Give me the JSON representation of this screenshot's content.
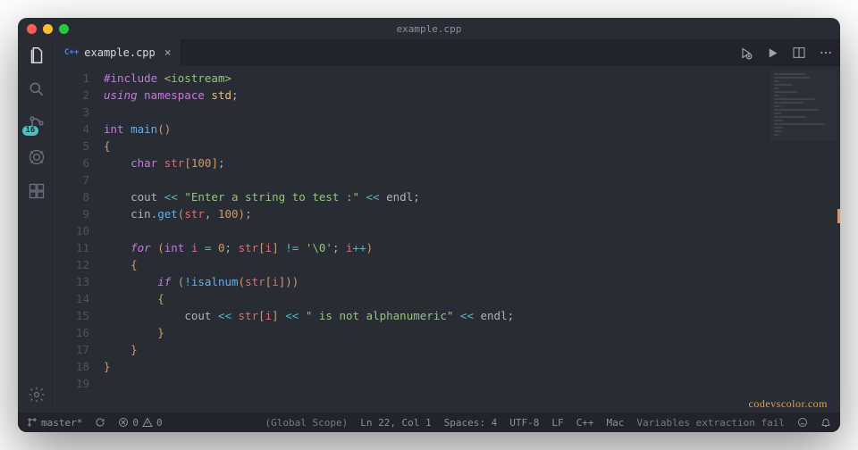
{
  "window": {
    "title": "example.cpp"
  },
  "tab": {
    "lang": "C++",
    "name": "example.cpp"
  },
  "activity": {
    "scm_badge": "16"
  },
  "code": {
    "lines": [
      {
        "n": 1,
        "tokens": [
          [
            "inc",
            "#include "
          ],
          [
            "hdr",
            "<iostream>"
          ]
        ]
      },
      {
        "n": 2,
        "tokens": [
          [
            "kw",
            "using "
          ],
          [
            "kw2",
            "namespace "
          ],
          [
            "ns",
            "std"
          ],
          [
            "pun",
            ";"
          ]
        ]
      },
      {
        "n": 3,
        "tokens": []
      },
      {
        "n": 4,
        "tokens": [
          [
            "ty",
            "int "
          ],
          [
            "fn",
            "main"
          ],
          [
            "br",
            "()"
          ]
        ]
      },
      {
        "n": 5,
        "tokens": [
          [
            "br",
            "{"
          ]
        ]
      },
      {
        "n": 6,
        "tokens": [
          [
            "id",
            "    "
          ],
          [
            "ty",
            "char "
          ],
          [
            "var",
            "str"
          ],
          [
            "br",
            "["
          ],
          [
            "num",
            "100"
          ],
          [
            "br",
            "]"
          ],
          [
            "pun",
            ";"
          ]
        ]
      },
      {
        "n": 7,
        "tokens": []
      },
      {
        "n": 8,
        "tokens": [
          [
            "id",
            "    "
          ],
          [
            "id",
            "cout "
          ],
          [
            "op",
            "<< "
          ],
          [
            "str",
            "\"Enter a string to test :\""
          ],
          [
            "op",
            " << "
          ],
          [
            "id",
            "endl"
          ],
          [
            "pun",
            ";"
          ]
        ]
      },
      {
        "n": 9,
        "tokens": [
          [
            "id",
            "    "
          ],
          [
            "id",
            "cin"
          ],
          [
            "pun",
            "."
          ],
          [
            "fn",
            "get"
          ],
          [
            "br",
            "("
          ],
          [
            "var",
            "str"
          ],
          [
            "pun",
            ", "
          ],
          [
            "num",
            "100"
          ],
          [
            "br",
            ")"
          ],
          [
            "pun",
            ";"
          ]
        ]
      },
      {
        "n": 10,
        "tokens": []
      },
      {
        "n": 11,
        "tokens": [
          [
            "id",
            "    "
          ],
          [
            "kw",
            "for "
          ],
          [
            "br",
            "("
          ],
          [
            "ty",
            "int "
          ],
          [
            "var",
            "i"
          ],
          [
            "op",
            " = "
          ],
          [
            "num",
            "0"
          ],
          [
            "pun",
            "; "
          ],
          [
            "var",
            "str"
          ],
          [
            "br",
            "["
          ],
          [
            "var",
            "i"
          ],
          [
            "br",
            "]"
          ],
          [
            "op",
            " != "
          ],
          [
            "chr",
            "'\\0'"
          ],
          [
            "pun",
            "; "
          ],
          [
            "var",
            "i"
          ],
          [
            "op",
            "++"
          ],
          [
            "br",
            ")"
          ]
        ]
      },
      {
        "n": 12,
        "tokens": [
          [
            "id",
            "    "
          ],
          [
            "br",
            "{"
          ]
        ]
      },
      {
        "n": 13,
        "tokens": [
          [
            "id",
            "        "
          ],
          [
            "kw",
            "if "
          ],
          [
            "br",
            "("
          ],
          [
            "op",
            "!"
          ],
          [
            "fn",
            "isalnum"
          ],
          [
            "br",
            "("
          ],
          [
            "var",
            "str"
          ],
          [
            "br",
            "["
          ],
          [
            "var",
            "i"
          ],
          [
            "br",
            "]"
          ],
          [
            "br",
            ")"
          ],
          [
            "br",
            ")"
          ]
        ]
      },
      {
        "n": 14,
        "tokens": [
          [
            "id",
            "        "
          ],
          [
            "br",
            "{"
          ]
        ]
      },
      {
        "n": 15,
        "tokens": [
          [
            "id",
            "            "
          ],
          [
            "id",
            "cout "
          ],
          [
            "op",
            "<< "
          ],
          [
            "var",
            "str"
          ],
          [
            "br",
            "["
          ],
          [
            "var",
            "i"
          ],
          [
            "br",
            "]"
          ],
          [
            "op",
            " << "
          ],
          [
            "str",
            "\" is not alphanumeric\""
          ],
          [
            "op",
            " << "
          ],
          [
            "id",
            "endl"
          ],
          [
            "pun",
            ";"
          ]
        ]
      },
      {
        "n": 16,
        "tokens": [
          [
            "id",
            "        "
          ],
          [
            "br",
            "}"
          ]
        ]
      },
      {
        "n": 17,
        "tokens": [
          [
            "id",
            "    "
          ],
          [
            "br",
            "}"
          ]
        ]
      },
      {
        "n": 18,
        "tokens": [
          [
            "br",
            "}"
          ]
        ]
      },
      {
        "n": 19,
        "tokens": []
      }
    ]
  },
  "status": {
    "branch": "master*",
    "errors": "0",
    "warnings": "0",
    "scope": "(Global Scope)",
    "cursor": "Ln 22, Col 1",
    "spaces": "Spaces: 4",
    "encoding": "UTF-8",
    "eol": "LF",
    "lang": "C++",
    "os": "Mac",
    "msg": "Variables extraction fail"
  },
  "watermark": "codevscolor.com"
}
